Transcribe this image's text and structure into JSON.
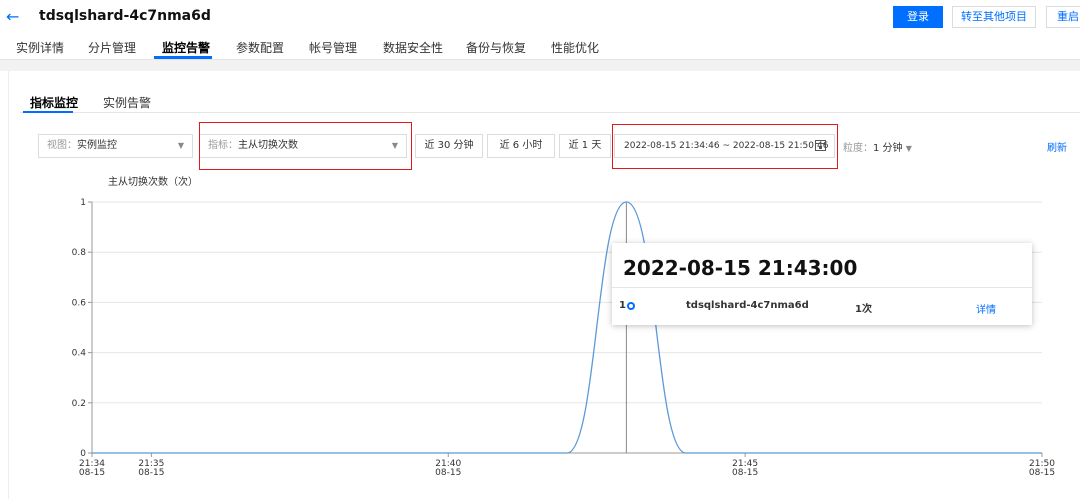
{
  "header": {
    "back_icon": "arrow-left-icon",
    "title": "tdsqlshard-4c7nma6d",
    "login_label": "登录",
    "goto_project_label": "转至其他项目",
    "restart_label": "重启"
  },
  "tabs": [
    {
      "label": "实例详情"
    },
    {
      "label": "分片管理"
    },
    {
      "label": "监控告警"
    },
    {
      "label": "参数配置"
    },
    {
      "label": "帐号管理"
    },
    {
      "label": "数据安全性"
    },
    {
      "label": "备份与恢复"
    },
    {
      "label": "性能优化"
    }
  ],
  "subtabs": [
    {
      "label": "指标监控"
    },
    {
      "label": "实例告警"
    }
  ],
  "toolbar": {
    "view_label": "视图：",
    "view_value": "实例监控",
    "metric_label": "指标：",
    "metric_value": "主从切换次数",
    "range_30m": "近 30 分钟",
    "range_6h": "近 6 小时",
    "range_1d": "近 1 天",
    "date_range": "2022-08-15 21:34:46 ~ 2022-08-15 21:50:46",
    "granularity_label": "粒度：",
    "granularity_value": "1 分钟",
    "refresh_label": "刷新"
  },
  "tooltip": {
    "time": "2022-08-15 21:43:00",
    "index": "1",
    "instance": "tdsqlshard-4c7nma6d",
    "value": "1次",
    "detail_label": "详情"
  },
  "colors": {
    "accent": "#006eff",
    "highlight": "#e0191b",
    "series": "#5b9bd5"
  },
  "chart_data": {
    "type": "line",
    "title": "主从切换次数（次）",
    "ylim": [
      0,
      1
    ],
    "yticks": [
      "0",
      "0.2",
      "0.4",
      "0.6",
      "0.8",
      "1"
    ],
    "xticks": [
      {
        "time": "21:34",
        "date": "08-15"
      },
      {
        "time": "21:35",
        "date": "08-15"
      },
      {
        "time": "21:40",
        "date": "08-15"
      },
      {
        "time": "21:45",
        "date": "08-15"
      },
      {
        "time": "21:50",
        "date": "08-15"
      }
    ],
    "xtick_minutes": [
      34,
      35,
      40,
      45,
      50
    ],
    "x": [
      "21:34",
      "21:35",
      "21:36",
      "21:37",
      "21:38",
      "21:39",
      "21:40",
      "21:41",
      "21:42",
      "21:43",
      "21:44",
      "21:45",
      "21:46",
      "21:47",
      "21:48",
      "21:49",
      "21:50"
    ],
    "values": [
      0,
      0,
      0,
      0,
      0,
      0,
      0,
      0,
      0,
      1,
      0,
      0,
      0,
      0,
      0,
      0,
      0
    ],
    "grid": true
  }
}
